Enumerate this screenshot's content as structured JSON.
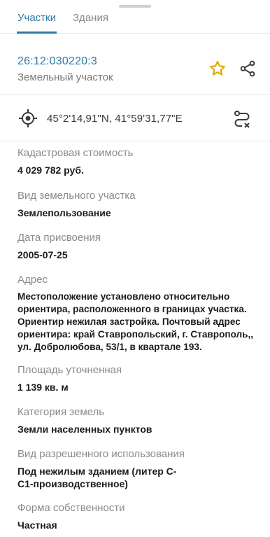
{
  "tabs": [
    {
      "label": "Участки",
      "active": true
    },
    {
      "label": "Здания",
      "active": false
    }
  ],
  "object": {
    "cadastral_number": "26:12:030220:3",
    "type": "Земельный участок"
  },
  "coordinates": "45°2'14,91\"N, 41°59'31,77\"E",
  "fields": [
    {
      "label": "Кадастровая стоимость",
      "value": "4 029 782 руб."
    },
    {
      "label": "Вид земельного участка",
      "value": "Землепользование"
    },
    {
      "label": "Дата присвоения",
      "value": "2005-07-25"
    },
    {
      "label": "Адрес",
      "value": "Местоположение установлено относительно ориентира, расположенного в границах участка. Ориентир нежилая застройка. Почтовый адрес ориентира: край Ставропольский, г. Ставрополь,, ул. Добролюбова, 53/1, в квартале 193."
    },
    {
      "label": "Площадь уточненная",
      "value": "1 139 кв. м"
    },
    {
      "label": "Категория земель",
      "value": "Земли населенных пунктов"
    },
    {
      "label": "Вид разрешенного использования",
      "value": "Под нежилым зданием (литер С-С1-производственное)"
    },
    {
      "label": "Форма собственности",
      "value": "Частная"
    }
  ],
  "icons": {
    "star": "star-icon",
    "share": "share-icon",
    "location": "target-location-icon",
    "route": "route-icon"
  },
  "colors": {
    "accent": "#2f78a3",
    "star": "#f2b705"
  }
}
